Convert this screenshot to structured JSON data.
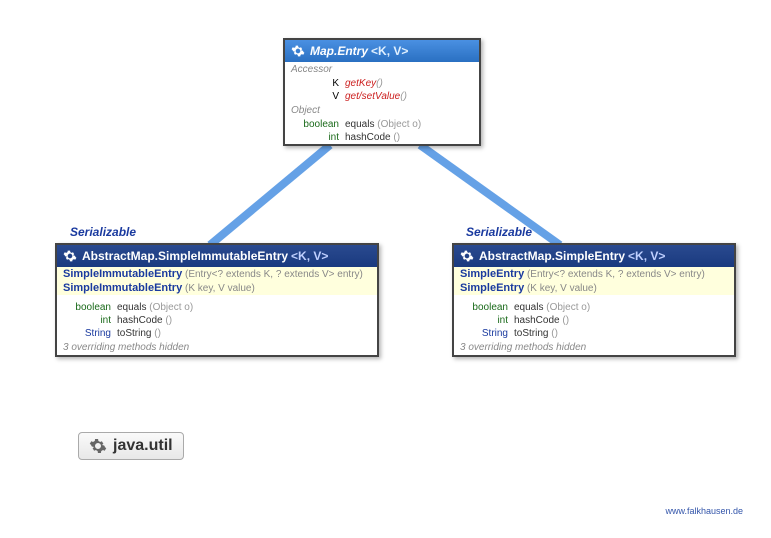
{
  "packageName": "java.util",
  "footer": "www.falkhausen.de",
  "interface": {
    "name": "Map.Entry",
    "typeParams": "<K, V>",
    "sections": [
      {
        "label": "Accessor",
        "members": [
          {
            "retType": "K",
            "retKind": "generic",
            "name": "getKey",
            "nameKind": "abstract",
            "params": "()"
          },
          {
            "retType": "V",
            "retKind": "generic",
            "name": "get/setValue",
            "nameKind": "abstract",
            "params": "()"
          }
        ]
      },
      {
        "label": "Object",
        "members": [
          {
            "retType": "boolean",
            "retKind": "keyword",
            "name": "equals",
            "nameKind": "normal",
            "params": "(Object o)"
          },
          {
            "retType": "int",
            "retKind": "keyword",
            "name": "hashCode",
            "nameKind": "normal",
            "params": "()"
          }
        ]
      }
    ]
  },
  "classes": [
    {
      "stereotype": "Serializable",
      "name": "AbstractMap.SimpleImmutableEntry",
      "typeParams": "<K, V>",
      "ctors": [
        {
          "name": "SimpleImmutableEntry",
          "params": "(Entry<? extends K, ? extends V> entry)"
        },
        {
          "name": "SimpleImmutableEntry",
          "params": "(K key, V value)"
        }
      ],
      "members": [
        {
          "retType": "boolean",
          "retKind": "keyword",
          "name": "equals",
          "params": "(Object o)"
        },
        {
          "retType": "int",
          "retKind": "keyword",
          "name": "hashCode",
          "params": "()"
        },
        {
          "retType": "String",
          "retKind": "class",
          "name": "toString",
          "params": "()"
        }
      ],
      "hiddenNote": "3 overriding methods hidden"
    },
    {
      "stereotype": "Serializable",
      "name": "AbstractMap.SimpleEntry",
      "typeParams": "<K, V>",
      "ctors": [
        {
          "name": "SimpleEntry",
          "params": "(Entry<? extends K, ? extends V> entry)"
        },
        {
          "name": "SimpleEntry",
          "params": "(K key, V value)"
        }
      ],
      "members": [
        {
          "retType": "boolean",
          "retKind": "keyword",
          "name": "equals",
          "params": "(Object o)"
        },
        {
          "retType": "int",
          "retKind": "keyword",
          "name": "hashCode",
          "params": "()"
        },
        {
          "retType": "String",
          "retKind": "class",
          "name": "toString",
          "params": "()"
        }
      ],
      "hiddenNote": "3 overriding methods hidden"
    }
  ]
}
